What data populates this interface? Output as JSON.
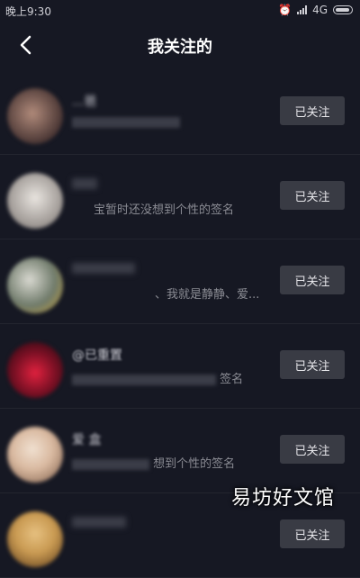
{
  "status_bar": {
    "time": "晚上9:30",
    "network": "4G"
  },
  "header": {
    "title": "我关注的",
    "back_icon": "chevron-left-icon"
  },
  "rows": [
    {
      "name": "...爸",
      "signature": "",
      "button": "已关注",
      "avatar_colors": [
        "#b08a7a",
        "#3b2a2a"
      ]
    },
    {
      "name": "",
      "signature": "宝暂时还没想到个性的签名",
      "button": "已关注",
      "avatar_colors": [
        "#c9c4c0",
        "#e8e4df"
      ]
    },
    {
      "name": "",
      "signature": "、我就是静静、爱...",
      "button": "已关注",
      "avatar_colors": [
        "#6f7a6a",
        "#c9a23a"
      ]
    },
    {
      "name": "@已重置",
      "signature": "签名",
      "button": "已关注",
      "avatar_colors": [
        "#e0213e",
        "#3a0d17"
      ]
    },
    {
      "name": "爱 盒",
      "signature": "想到个性的签名",
      "button": "已关注",
      "avatar_colors": [
        "#d9b9a0",
        "#7a5a46"
      ]
    },
    {
      "name": "",
      "signature": "",
      "button": "已关注",
      "avatar_colors": [
        "#c99a52",
        "#5a3a1a"
      ]
    }
  ],
  "watermark": "易坊好文馆"
}
